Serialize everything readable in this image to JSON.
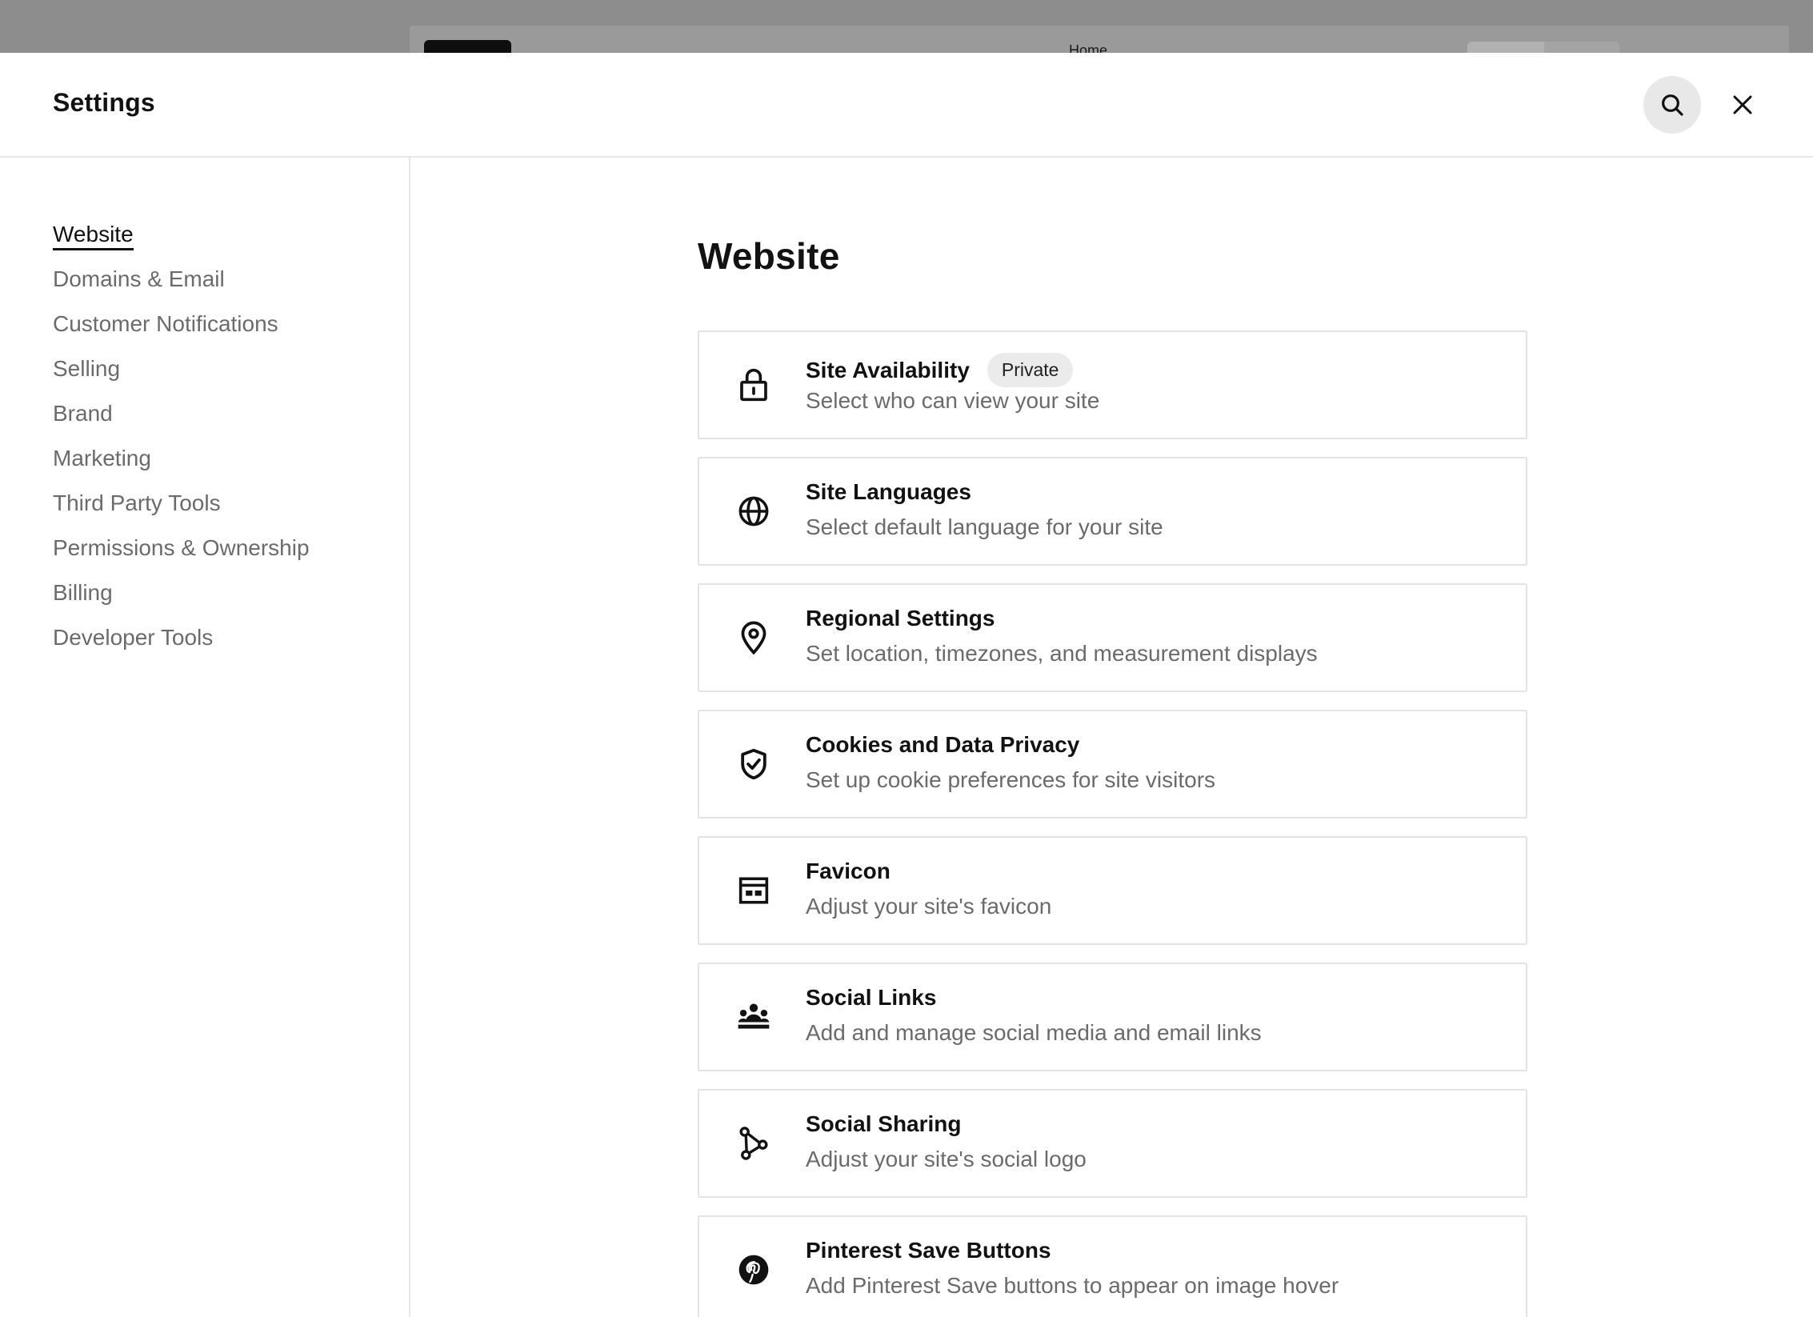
{
  "backdrop": {
    "page_label": "Home"
  },
  "header": {
    "title": "Settings",
    "search_icon": "search-icon",
    "close_icon": "close-icon"
  },
  "sidebar": {
    "items": [
      {
        "label": "Website",
        "active": true
      },
      {
        "label": "Domains & Email"
      },
      {
        "label": "Customer Notifications"
      },
      {
        "label": "Selling"
      },
      {
        "label": "Brand"
      },
      {
        "label": "Marketing"
      },
      {
        "label": "Third Party Tools"
      },
      {
        "label": "Permissions & Ownership"
      },
      {
        "label": "Billing"
      },
      {
        "label": "Developer Tools"
      }
    ]
  },
  "main": {
    "title": "Website",
    "cards": [
      {
        "title": "Site Availability",
        "badge": "Private",
        "desc": "Select who can view your site",
        "icon": "lock-icon"
      },
      {
        "title": "Site Languages",
        "desc": "Select default language for your site",
        "icon": "globe-icon"
      },
      {
        "title": "Regional Settings",
        "desc": "Set location, timezones, and measurement displays",
        "icon": "location-pin-icon"
      },
      {
        "title": "Cookies and Data Privacy",
        "desc": "Set up cookie preferences for site visitors",
        "icon": "shield-check-icon"
      },
      {
        "title": "Favicon",
        "desc": "Adjust your site's favicon",
        "icon": "favicon-icon"
      },
      {
        "title": "Social Links",
        "desc": "Add and manage social media and email links",
        "icon": "people-icon"
      },
      {
        "title": "Social Sharing",
        "desc": "Adjust your site's social logo",
        "icon": "share-icon"
      },
      {
        "title": "Pinterest Save Buttons",
        "desc": "Add Pinterest Save buttons to appear on image hover",
        "icon": "pinterest-icon"
      }
    ]
  }
}
